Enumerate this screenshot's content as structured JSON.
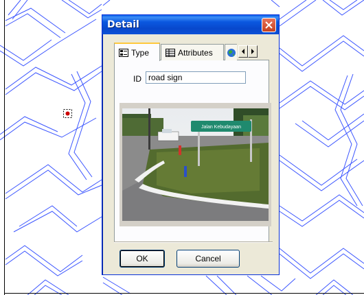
{
  "dialog": {
    "title": "Detail",
    "close_icon": "close-icon",
    "tabs": [
      {
        "label": "Type",
        "icon": "type-tab-icon",
        "active": true
      },
      {
        "label": "Attributes",
        "icon": "table-icon",
        "active": false
      },
      {
        "label": "",
        "icon": "globe-icon",
        "active": false
      }
    ],
    "id_label": "ID",
    "id_value": "road sign",
    "photo": {
      "description": "road-sign-photo",
      "sign_text": "Jalan Kebudayaan"
    },
    "ok_label": "OK",
    "cancel_label": "Cancel"
  },
  "map": {
    "road_color": "#2b3bff",
    "marker": "gps-point-marker"
  },
  "colors": {
    "titlebar": "#0a58e0",
    "dialog_bg": "#ece9d8",
    "close_btn": "#d9542f"
  }
}
